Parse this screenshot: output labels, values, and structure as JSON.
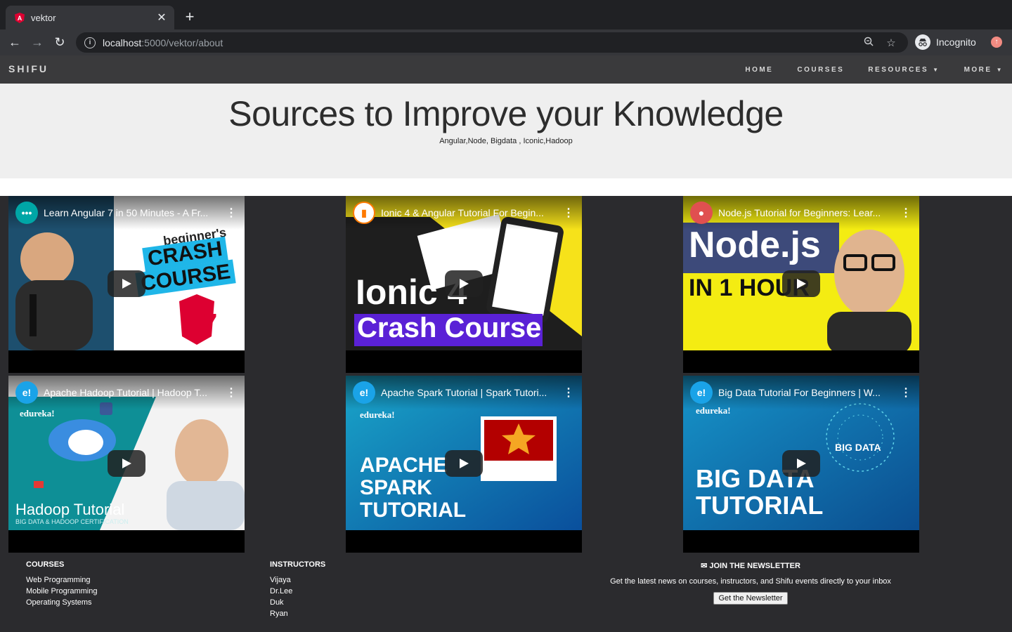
{
  "browser": {
    "tab_title": "vektor",
    "url_host": "localhost",
    "url_path": ":5000/vektor/about",
    "profile_label": "Incognito"
  },
  "site": {
    "brand": "SHIFU",
    "nav": [
      {
        "label": "HOME",
        "has_caret": false
      },
      {
        "label": "COURSES",
        "has_caret": false
      },
      {
        "label": "RESOURCES",
        "has_caret": true
      },
      {
        "label": "MORE",
        "has_caret": true
      }
    ]
  },
  "hero": {
    "title": "Sources to Improve your Knowledge",
    "subtitle": "Angular,Node, Bigdata , Iconic,Hadoop"
  },
  "videos": [
    {
      "title": "Learn Angular 7 in 50 Minutes - A Fr...",
      "channel_color": "#00a6a6",
      "thumb_text": [
        "beginner's",
        "CRASH",
        "COURSE",
        "7"
      ]
    },
    {
      "title": "Ionic 4 & Angular Tutorial For Begin...",
      "channel_color": "#ff7a00",
      "thumb_text": [
        "Ionic 4",
        "Crash Course"
      ]
    },
    {
      "title": "Node.js Tutorial for Beginners: Lear...",
      "channel_color": "#d33",
      "thumb_text": [
        "Node.js",
        "IN 1 HOUR"
      ]
    },
    {
      "title": "Apache Hadoop Tutorial | Hadoop T...",
      "channel_color": "#1aa3e8",
      "thumb_text": [
        "edureka!",
        "Hadoop Tutorial",
        "BIG DATA & HADOOP CERTIFICATION"
      ]
    },
    {
      "title": "Apache Spark Tutorial | Spark Tutori...",
      "channel_color": "#1aa3e8",
      "thumb_text": [
        "edureka!",
        "APACHE",
        "SPARK",
        "TUTORIAL"
      ]
    },
    {
      "title": "Big Data Tutorial For Beginners | W...",
      "channel_color": "#1aa3e8",
      "thumb_text": [
        "edureka!",
        "BIG DATA",
        "BIG DATA",
        "TUTORIAL"
      ]
    }
  ],
  "footer": {
    "courses_heading": "COURSES",
    "courses": [
      "Web Programming",
      "Mobile Programming",
      "Operating Systems"
    ],
    "instructors_heading": "INSTRUCTORS",
    "instructors": [
      "Vijaya",
      "Dr.Lee",
      "Duk",
      "Ryan"
    ],
    "newsletter_heading": "JOIN THE NEWSLETTER",
    "newsletter_text": "Get the latest news on courses, instructors, and Shifu events directly to your inbox",
    "newsletter_button": "Get the Newsletter"
  }
}
